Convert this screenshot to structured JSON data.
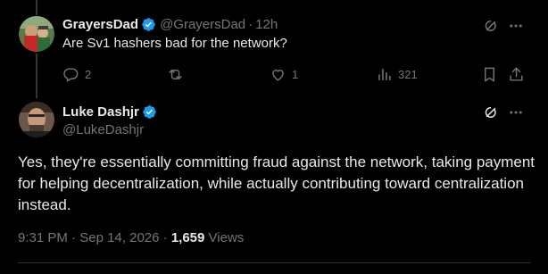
{
  "reply": {
    "author_name": "GrayersDad",
    "author_handle": "@GrayersDad",
    "separator": "·",
    "time": "12h",
    "text": "Are Sv1 hashers bad for the network?",
    "actions": {
      "replies": "2",
      "reposts": "",
      "likes": "1",
      "views": "321"
    }
  },
  "tweet": {
    "author_name": "Luke Dashjr",
    "author_handle": "@LukeDashjr",
    "text": "Yes, they're essentially committing fraud against the network, taking payment for helping decentralization, while actually contributing toward centralization instead.",
    "time": "9:31 PM",
    "date_separator": "·",
    "date": "Sep 14, 2026",
    "views_separator": "·",
    "views_count": "1,659",
    "views_label": "Views"
  },
  "colors": {
    "background": "#000000",
    "text_primary": "#e7e9ea",
    "text_secondary": "#71767b",
    "verified_blue": "#1d9bf0",
    "divider": "#2f3336"
  },
  "icons": [
    "verified-badge-icon",
    "grok-icon",
    "more-icon",
    "reply-icon",
    "repost-icon",
    "like-icon",
    "analytics-icon",
    "bookmark-icon"
  ]
}
